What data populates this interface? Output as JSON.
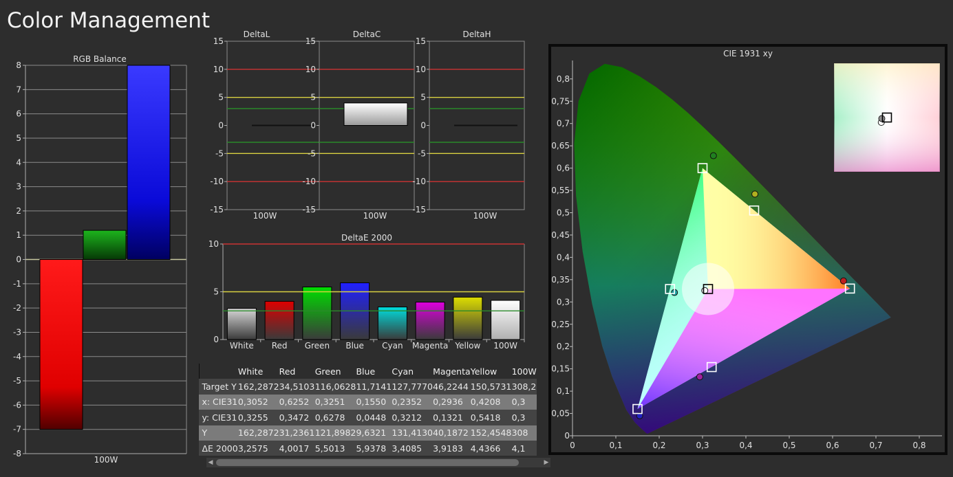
{
  "page": {
    "title": "Color Management"
  },
  "colors": {
    "background": "#2d2d2d",
    "grid": "#a0a0a0",
    "red": "#ff0000",
    "green": "#00aa00",
    "blue": "#0000ff"
  },
  "chart_data": [
    {
      "id": "rgb_balance",
      "type": "bar",
      "title": "RGB Balance",
      "categories": [
        "100W"
      ],
      "series": [
        {
          "values": [
            -7.0
          ],
          "color": "#ff0000"
        },
        {
          "values": [
            1.2
          ],
          "color": "#00b000"
        },
        {
          "values": [
            8.0
          ],
          "color": "#0000ff"
        }
      ],
      "ylim": [
        -8,
        8
      ],
      "yticks": [
        8,
        7,
        6,
        5,
        4,
        3,
        2,
        1,
        0,
        -1,
        -2,
        -3,
        -4,
        -5,
        -6,
        -7,
        -8
      ],
      "grid": true
    },
    {
      "id": "delta_l",
      "type": "bar",
      "title": "DeltaL",
      "categories": [
        "100W"
      ],
      "values": [
        0.0
      ],
      "ylim": [
        -15,
        15
      ],
      "yticks": [
        15,
        10,
        5,
        0,
        -5,
        -10,
        -15
      ],
      "reference_lines": [
        {
          "y": 10,
          "color": "#cc3333"
        },
        {
          "y": 5,
          "color": "#d8d040"
        },
        {
          "y": 3,
          "color": "#2a8a2a"
        },
        {
          "y": -3,
          "color": "#2a8a2a"
        },
        {
          "y": -5,
          "color": "#d8d040"
        },
        {
          "y": -10,
          "color": "#cc3333"
        }
      ]
    },
    {
      "id": "delta_c",
      "type": "bar",
      "title": "DeltaC",
      "categories": [
        "100W"
      ],
      "values": [
        4.0
      ],
      "ylim": [
        -15,
        15
      ],
      "yticks": [
        15,
        10,
        5,
        0,
        -5,
        -10,
        -15
      ],
      "reference_lines": [
        {
          "y": 10,
          "color": "#cc3333"
        },
        {
          "y": 5,
          "color": "#d8d040"
        },
        {
          "y": 3,
          "color": "#2a8a2a"
        },
        {
          "y": -3,
          "color": "#2a8a2a"
        },
        {
          "y": -5,
          "color": "#d8d040"
        },
        {
          "y": -10,
          "color": "#cc3333"
        }
      ]
    },
    {
      "id": "delta_h",
      "type": "bar",
      "title": "DeltaH",
      "categories": [
        "100W"
      ],
      "values": [
        0.0
      ],
      "ylim": [
        -15,
        15
      ],
      "yticks": [
        15,
        10,
        5,
        0,
        -5,
        -10,
        -15
      ],
      "reference_lines": [
        {
          "y": 10,
          "color": "#cc3333"
        },
        {
          "y": 5,
          "color": "#d8d040"
        },
        {
          "y": 3,
          "color": "#2a8a2a"
        },
        {
          "y": -3,
          "color": "#2a8a2a"
        },
        {
          "y": -5,
          "color": "#d8d040"
        },
        {
          "y": -10,
          "color": "#cc3333"
        }
      ]
    },
    {
      "id": "delta_e",
      "type": "bar",
      "title": "DeltaE 2000",
      "categories": [
        "White",
        "Red",
        "Green",
        "Blue",
        "Cyan",
        "Magenta",
        "Yellow",
        "100W"
      ],
      "values": [
        3.2575,
        4.0017,
        5.5013,
        5.9378,
        3.4085,
        3.9183,
        4.4366,
        4.1
      ],
      "colors": [
        "#d8d8d8",
        "#dd0000",
        "#00dd00",
        "#2020ff",
        "#00dddd",
        "#dd00dd",
        "#dddd00",
        "#ffffff"
      ],
      "ylim": [
        0,
        10
      ],
      "yticks": [
        10,
        5,
        0
      ],
      "reference_lines": [
        {
          "y": 10,
          "color": "#cc3333"
        },
        {
          "y": 5,
          "color": "#d8d040"
        },
        {
          "y": 3,
          "color": "#2a8a2a"
        }
      ]
    },
    {
      "id": "cie_xy",
      "type": "scatter",
      "title": "CIE 1931 xy",
      "xlim": [
        0,
        0.85
      ],
      "ylim": [
        0,
        0.85
      ],
      "xticks": [
        "0",
        "0,1",
        "0,2",
        "0,3",
        "0,4",
        "0,5",
        "0,6",
        "0,7",
        "0,8"
      ],
      "yticks": [
        "0",
        "0,05",
        "0,1",
        "0,15",
        "0,2",
        "0,25",
        "0,3",
        "0,35",
        "0,4",
        "0,45",
        "0,5",
        "0,55",
        "0,6",
        "0,65",
        "0,7",
        "0,75",
        "0,8"
      ],
      "targets": [
        {
          "name": "White",
          "x": 0.3127,
          "y": 0.329
        },
        {
          "name": "Red",
          "x": 0.64,
          "y": 0.33
        },
        {
          "name": "Green",
          "x": 0.3,
          "y": 0.6
        },
        {
          "name": "Blue",
          "x": 0.15,
          "y": 0.06
        },
        {
          "name": "Cyan",
          "x": 0.225,
          "y": 0.329
        },
        {
          "name": "Magenta",
          "x": 0.321,
          "y": 0.154
        },
        {
          "name": "Yellow",
          "x": 0.419,
          "y": 0.505
        }
      ],
      "measured": [
        {
          "name": "White",
          "x": 0.3052,
          "y": 0.3255
        },
        {
          "name": "Red",
          "x": 0.6252,
          "y": 0.3472
        },
        {
          "name": "Green",
          "x": 0.3251,
          "y": 0.6278
        },
        {
          "name": "Blue",
          "x": 0.155,
          "y": 0.0448
        },
        {
          "name": "Cyan",
          "x": 0.2352,
          "y": 0.3212
        },
        {
          "name": "Magenta",
          "x": 0.2936,
          "y": 0.1321
        },
        {
          "name": "Yellow",
          "x": 0.4208,
          "y": 0.5418
        }
      ],
      "inset": {
        "target": [
          0.3127,
          0.329
        ],
        "points": [
          [
            0.3052,
            0.3255
          ],
          [
            0.3045,
            0.324
          ]
        ]
      }
    }
  ],
  "table": {
    "columns": [
      "White",
      "Red",
      "Green",
      "Blue",
      "Cyan",
      "Magenta",
      "Yellow",
      "100W"
    ],
    "rows": [
      {
        "label": "Target Y",
        "values": [
          "162,2872",
          "34,5103",
          "116,0628",
          "11,7141",
          "127,7770",
          "46,2244",
          "150,5731",
          "308,2"
        ]
      },
      {
        "label": "x: CIE31",
        "values": [
          "0,3052",
          "0,6252",
          "0,3251",
          "0,1550",
          "0,2352",
          "0,2936",
          "0,4208",
          "0,3"
        ]
      },
      {
        "label": "y: CIE31",
        "values": [
          "0,3255",
          "0,3472",
          "0,6278",
          "0,0448",
          "0,3212",
          "0,1321",
          "0,5418",
          "0,3"
        ]
      },
      {
        "label": "Y",
        "values": [
          "162,2872",
          "31,2361",
          "121,8982",
          "9,6321",
          "131,4130",
          "40,1872",
          "152,4548",
          "308"
        ]
      },
      {
        "label": "ΔE 2000",
        "values": [
          "3,2575",
          "4,0017",
          "5,5013",
          "5,9378",
          "3,4085",
          "3,9183",
          "4,4366",
          "4,1"
        ]
      }
    ]
  }
}
